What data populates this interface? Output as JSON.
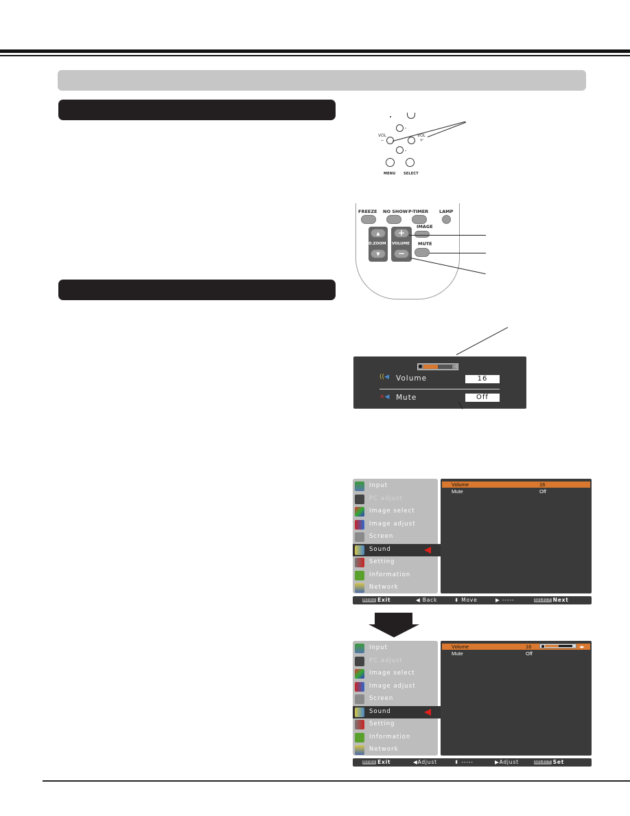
{
  "remote_panel": {
    "vol_minus_label": "VOL\n−",
    "vol_plus_label": "VOL\n+",
    "menu_label": "MENU",
    "select_label": "SELECT"
  },
  "remote": {
    "buttons_top": [
      "FREEZE",
      "NO SHOW",
      "P-TIMER",
      "LAMP"
    ],
    "image_label": "IMAGE",
    "dzoom_label": "D.ZOOM",
    "volume_label": "VOLUME",
    "mute_label": "MUTE",
    "plus": "+",
    "minus": "−"
  },
  "osd": {
    "volume_label": "Volume",
    "volume_value": "16",
    "mute_label": "Mute",
    "mute_value": "Off",
    "volume_level_fraction": 0.5
  },
  "menu1": {
    "items": [
      {
        "label": "Input",
        "icon": "input-icon"
      },
      {
        "label": "PC adjust",
        "icon": "pc-adjust-icon",
        "disabled": true
      },
      {
        "label": "Image select",
        "icon": "image-select-icon"
      },
      {
        "label": "Image adjust",
        "icon": "image-adjust-icon"
      },
      {
        "label": "Screen",
        "icon": "screen-icon"
      },
      {
        "label": "Sound",
        "icon": "sound-icon",
        "selected": true
      },
      {
        "label": "Setting",
        "icon": "setting-icon"
      },
      {
        "label": "Information",
        "icon": "information-icon"
      },
      {
        "label": "Network",
        "icon": "network-icon"
      }
    ],
    "rows": [
      {
        "label": "Volume",
        "value": "16",
        "active": true
      },
      {
        "label": "Mute",
        "value": "Off"
      }
    ],
    "status": {
      "exit": "Exit",
      "exit_key": "MENU",
      "back": "◀ Back",
      "move": "⬍ Move",
      "right": "▶ -----",
      "next_key": "SELECT",
      "next": "Next"
    }
  },
  "menu2": {
    "items": [
      {
        "label": "Input",
        "icon": "input-icon"
      },
      {
        "label": "PC adjust",
        "icon": "pc-adjust-icon",
        "disabled": true
      },
      {
        "label": "Image select",
        "icon": "image-select-icon"
      },
      {
        "label": "Image adjust",
        "icon": "image-adjust-icon"
      },
      {
        "label": "Screen",
        "icon": "screen-icon"
      },
      {
        "label": "Sound",
        "icon": "sound-icon",
        "selected": true
      },
      {
        "label": "Setting",
        "icon": "setting-icon"
      },
      {
        "label": "Information",
        "icon": "information-icon"
      },
      {
        "label": "Network",
        "icon": "network-icon"
      }
    ],
    "rows": [
      {
        "label": "Volume",
        "value": "16",
        "active": true,
        "level_fraction": 0.5
      },
      {
        "label": "Mute",
        "value": "Off"
      }
    ],
    "status": {
      "exit": "Exit",
      "exit_key": "MENU",
      "left": "◀Adjust",
      "updown": "⬍ -----",
      "right": "▶Adjust",
      "set_key": "SELECT",
      "set": "Set"
    }
  },
  "colors": {
    "accent_orange": "#d9782e",
    "selection_red": "#e0201b",
    "osd_bg": "#3a3a3a",
    "menu_left_bg": "#bdbdbd",
    "section_bar": "#c6c6c6",
    "sub_bar": "#231f20"
  }
}
